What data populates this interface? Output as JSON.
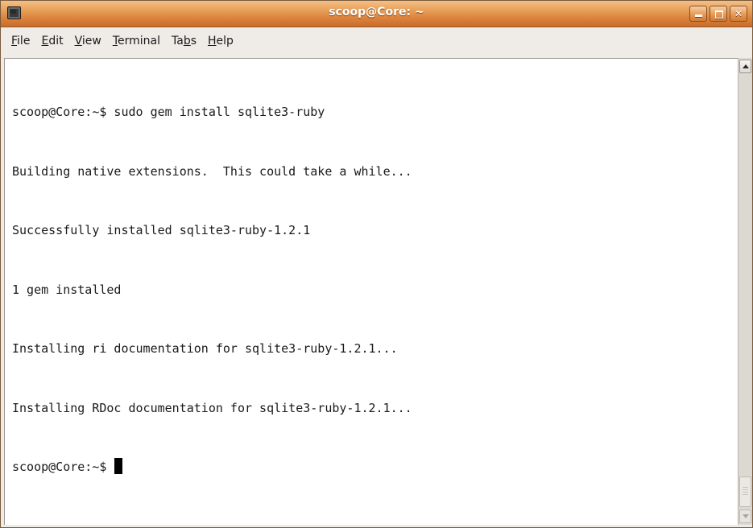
{
  "window": {
    "title": "scoop@Core: ~",
    "app_icon": "terminal-icon",
    "controls": {
      "minimize_icon": "minimize-icon",
      "maximize_icon": "maximize-icon",
      "close_icon": "close-icon",
      "close_glyph": "✕"
    }
  },
  "menu": {
    "items": [
      {
        "label_pre": "",
        "mnemonic": "F",
        "label_post": "ile"
      },
      {
        "label_pre": "",
        "mnemonic": "E",
        "label_post": "dit"
      },
      {
        "label_pre": "",
        "mnemonic": "V",
        "label_post": "iew"
      },
      {
        "label_pre": "",
        "mnemonic": "T",
        "label_post": "erminal"
      },
      {
        "label_pre": "Ta",
        "mnemonic": "b",
        "label_post": "s"
      },
      {
        "label_pre": "",
        "mnemonic": "H",
        "label_post": "elp"
      }
    ]
  },
  "terminal": {
    "lines": [
      "scoop@Core:~$ sudo gem install sqlite3-ruby",
      "Building native extensions.  This could take a while...",
      "Successfully installed sqlite3-ruby-1.2.1",
      "1 gem installed",
      "Installing ri documentation for sqlite3-ruby-1.2.1...",
      "Installing RDoc documentation for sqlite3-ruby-1.2.1..."
    ],
    "prompt": "scoop@Core:~$ ",
    "background_color": "#ffffff",
    "text_color": "#1a1a1a"
  },
  "scrollbar": {
    "position_fraction": 1.0
  },
  "colors": {
    "titlebar_accent": "#e08a43",
    "window_background": "#efebe7"
  }
}
